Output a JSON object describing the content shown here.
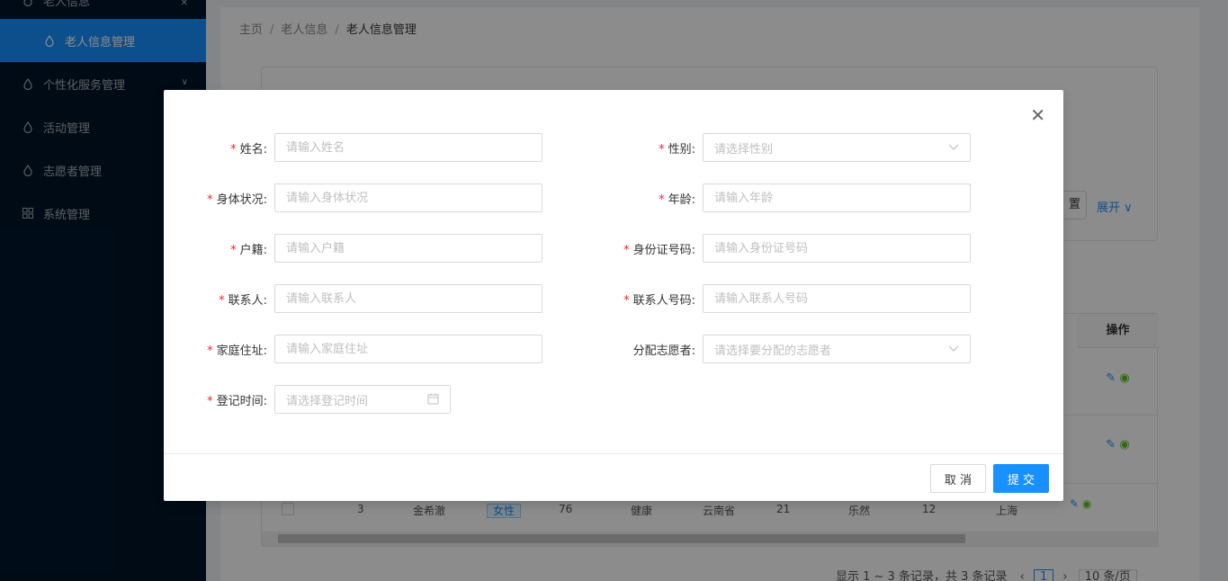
{
  "sidebar": {
    "items": [
      {
        "label": "老人信息"
      },
      {
        "label": "老人信息管理"
      },
      {
        "label": "个性化服务管理"
      },
      {
        "label": "活动管理"
      },
      {
        "label": "志愿者管理"
      },
      {
        "label": "系统管理"
      }
    ]
  },
  "breadcrumb": {
    "home": "主页",
    "parent": "老人信息",
    "current": "老人信息管理"
  },
  "search": {
    "reset_label": "置",
    "expand_label": "展开"
  },
  "table": {
    "op_header": "操作",
    "row3": {
      "index": "3",
      "name": "金希澈",
      "gender": "女性",
      "age": "76",
      "health": "健康",
      "origin": "云南省",
      "col7": "21",
      "contact": "乐然",
      "col9": "12",
      "address": "上海"
    }
  },
  "pager": {
    "summary": "显示 1 ~ 3 条记录，共 3 条记录",
    "page": "1",
    "size": "10 条/页"
  },
  "modal": {
    "fields": {
      "name": {
        "label": "姓名",
        "placeholder": "请输入姓名"
      },
      "gender": {
        "label": "性别",
        "placeholder": "请选择性别"
      },
      "health": {
        "label": "身体状况",
        "placeholder": "请输入身体状况"
      },
      "age": {
        "label": "年龄",
        "placeholder": "请输入年龄"
      },
      "household": {
        "label": "户籍",
        "placeholder": "请输入户籍"
      },
      "idcard": {
        "label": "身份证号码",
        "placeholder": "请输入身份证号码"
      },
      "contact": {
        "label": "联系人",
        "placeholder": "请输入联系人"
      },
      "contact_phone": {
        "label": "联系人号码",
        "placeholder": "请输入联系人号码"
      },
      "address": {
        "label": "家庭住址",
        "placeholder": "请输入家庭住址"
      },
      "volunteer": {
        "label": "分配志愿者",
        "placeholder": "请选择要分配的志愿者"
      },
      "register_time": {
        "label": "登记时间",
        "placeholder": "请选择登记时间"
      }
    },
    "cancel_label": "取 消",
    "submit_label": "提 交"
  },
  "colors": {
    "primary": "#1890ff",
    "sidebar_bg": "#001529",
    "required": "#f5222d"
  }
}
